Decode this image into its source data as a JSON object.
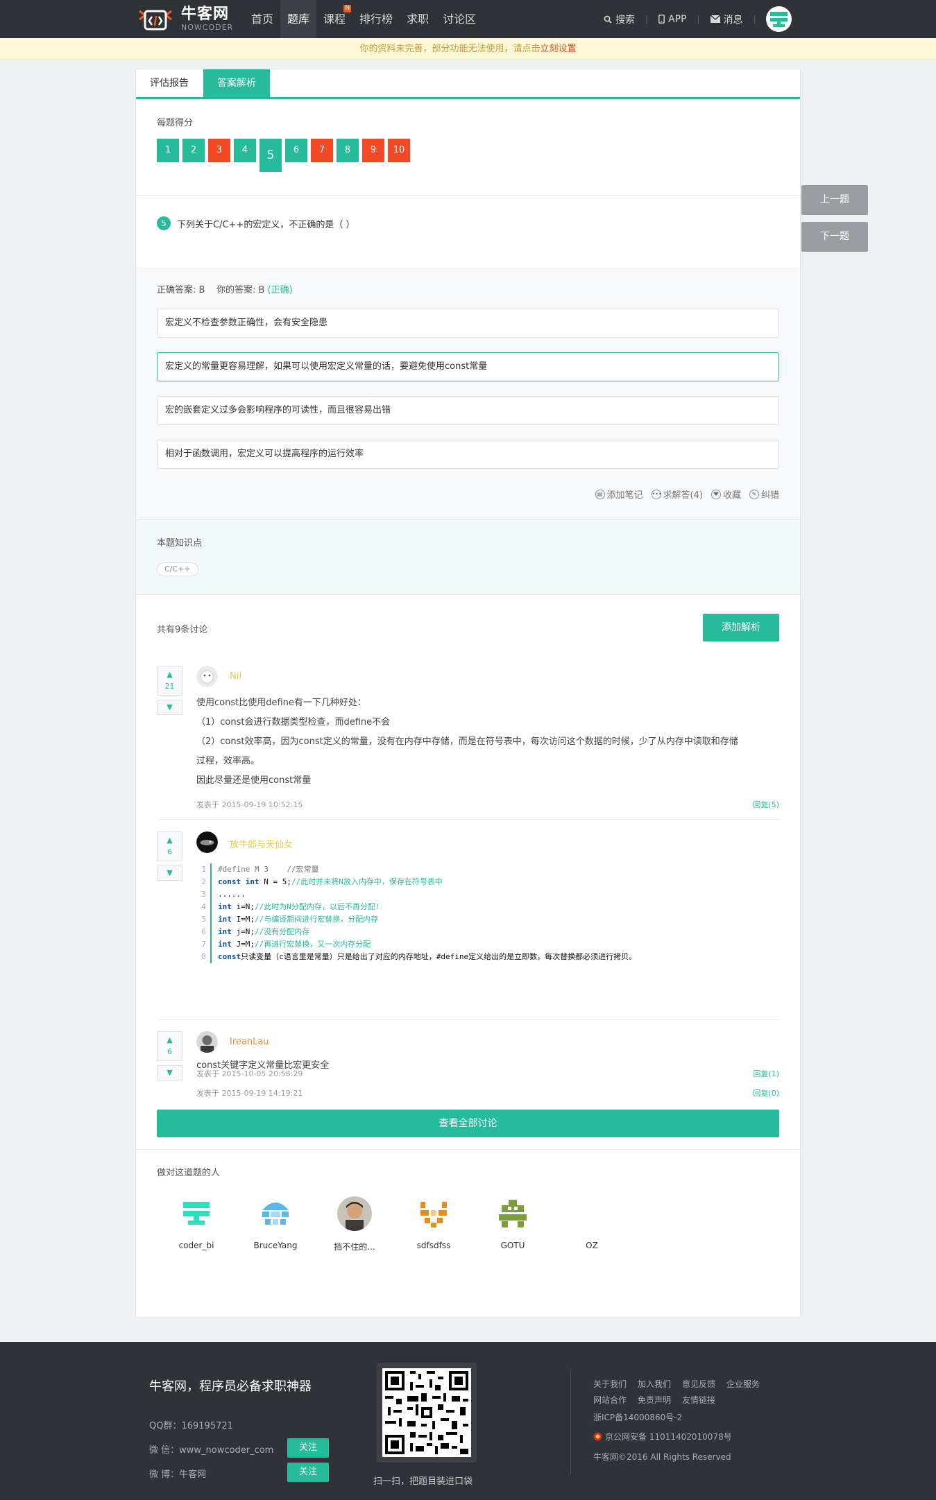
{
  "nav": {
    "logo_cn": "牛客网",
    "logo_en": "NOWCODER",
    "links": [
      "首页",
      "题库",
      "课程",
      "排行榜",
      "求职",
      "讨论区"
    ],
    "new_badge": "N",
    "search": "搜索",
    "app": "APP",
    "messages": "消息"
  },
  "notice": {
    "text": "你的资料未完善，部分功能无法使用，请点击",
    "link": "立刻设置"
  },
  "tabs": [
    "评估报告",
    "答案解析"
  ],
  "scores": {
    "label": "每题得分",
    "items": [
      {
        "n": "1",
        "status": "correct"
      },
      {
        "n": "2",
        "status": "correct"
      },
      {
        "n": "3",
        "status": "wrong"
      },
      {
        "n": "4",
        "status": "correct"
      },
      {
        "n": "5",
        "status": "correct"
      },
      {
        "n": "6",
        "status": "correct"
      },
      {
        "n": "7",
        "status": "wrong"
      },
      {
        "n": "8",
        "status": "correct"
      },
      {
        "n": "9",
        "status": "wrong"
      },
      {
        "n": "10",
        "status": "wrong"
      }
    ],
    "current": "5"
  },
  "question": {
    "number": "5",
    "text": "下列关于C/C++的宏定义，不正确的是（ ）"
  },
  "answer": {
    "correct_label": "正确答案: B",
    "yours_label": "你的答案: B",
    "result": "(正确)",
    "options": [
      "宏定义不检查参数正确性，会有安全隐患",
      "宏定义的常量更容易理解，如果可以使用宏定义常量的话，要避免使用const常量",
      "宏的嵌套定义过多会影响程序的可读性，而且很容易出错",
      "相对于函数调用，宏定义可以提高程序的运行效率"
    ],
    "actions": [
      "添加笔记",
      "求解答(4)",
      "收藏",
      "纠错"
    ]
  },
  "knowledge": {
    "label": "本题知识点",
    "tag": "C/C++"
  },
  "discussion": {
    "count": "共有9条讨论",
    "add_button": "添加解析",
    "comments": [
      {
        "votes": "21",
        "user": "Nil",
        "lines": [
          "使用const比使用define有一下几种好处：",
          "（1）const会进行数据类型检查，而define不会",
          "（2）const效率高，因为const定义的常量，没有在内存中存储，而是在符号表中，每次访问这个数据的时候，少了从内存中读取和存储",
          "过程，效率高。",
          "因此尽量还是使用const常量"
        ],
        "date": "发表于 2015-09-19 10:52:15",
        "reply": "回复(5)"
      },
      {
        "votes": "6",
        "user": "放牛郎与天仙女",
        "code": [
          "#define M 3    //宏常量",
          "const int N = 5;//此时并未将N放入内存中，保存在符号表中",
          "......",
          "int i=N;//此时为N分配内存，以后不再分配!",
          "int I=M;//与编译期间进行宏替换，分配内存",
          "int j=N;//没有分配内存",
          "int J=M;//再进行宏替换，又一次内存分配",
          "const只读变量（c语言里是常量）只是给出了对应的内存地址，#define定义给出的是立即数，每次替换都必须进行拷贝。"
        ],
        "date": "发表于 2015-10-05 20:58:29",
        "reply": "回复(1)"
      },
      {
        "votes": "6",
        "user": "IreanLau",
        "lines": [
          "const关键字定义常量比宏更安全"
        ],
        "date": "发表于 2015-09-19 14:19:21",
        "reply": "回复(0)"
      }
    ],
    "view_all": "查看全部讨论"
  },
  "solvers": {
    "label": "做对这道题的人",
    "people": [
      "coder_bi",
      "BruceYang",
      "挡不住的...",
      "sdfsdfss",
      "GOTU",
      "OZ"
    ]
  },
  "side": {
    "prev": "上一题",
    "next": "下一题"
  },
  "footer": {
    "title": "牛客网，程序员必备求职神器",
    "qq": "QQ群：169195721",
    "wechat": "微 信：www_nowcoder_com",
    "weibo": "微 博：牛客网",
    "follow": "关注",
    "scan": "扫一扫，把题目装进口袋",
    "links1": [
      "关于我们",
      "加入我们",
      "意见反馈",
      "企业服务"
    ],
    "links2": [
      "网站合作",
      "免责声明",
      "友情链接"
    ],
    "icp": "浙ICP备14000860号-2",
    "police": "京公网安备 11011402010078号",
    "copyright": "牛客网©2016 All Rights Reserved"
  },
  "colors": {
    "accent": "#25bb9b",
    "wrong": "#f24a26",
    "nav_bg": "#2f3237"
  }
}
